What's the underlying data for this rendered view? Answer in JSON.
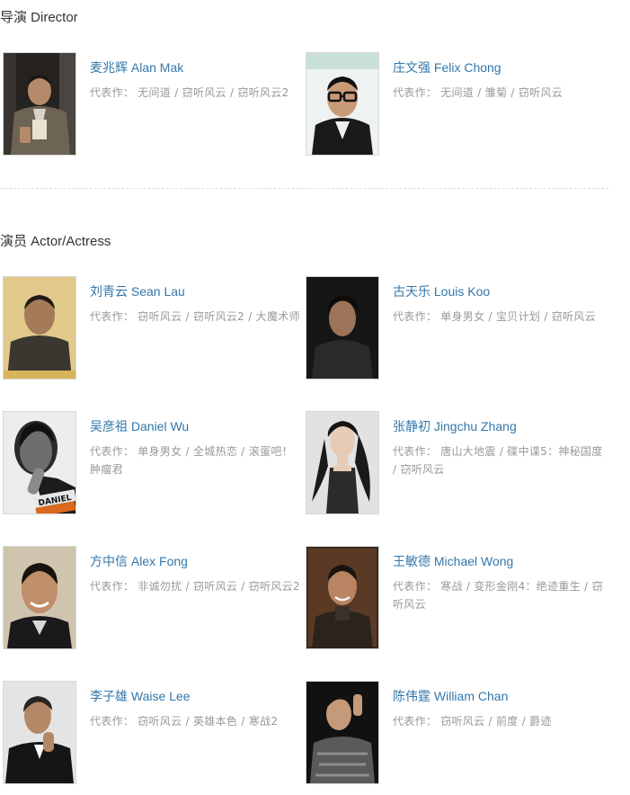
{
  "sections": {
    "director": {
      "title": "导演 Director",
      "people": [
        {
          "name": "麦兆辉 Alan Mak",
          "works_label": "代表作：",
          "works": "无间道 / 窃听风云 / 窃听风云2"
        },
        {
          "name": "庄文强 Felix Chong",
          "works_label": "代表作：",
          "works": "无间道 / 雏菊 / 窃听风云"
        }
      ]
    },
    "actor": {
      "title": "演员 Actor/Actress",
      "people": [
        {
          "name": "刘青云 Sean Lau",
          "works_label": "代表作：",
          "works": "窃听风云 / 窃听风云2 / 大魔术师"
        },
        {
          "name": "古天乐 Louis Koo",
          "works_label": "代表作：",
          "works": "单身男女 / 宝贝计划 / 窃听风云"
        },
        {
          "name": "吴彦祖 Daniel Wu",
          "works_label": "代表作：",
          "works": "单身男女 / 全城热恋 / 滚蛋吧！肿瘤君"
        },
        {
          "name": "张静初 Jingchu Zhang",
          "works_label": "代表作：",
          "works": "唐山大地震 / 碟中谍5：神秘国度 / 窃听风云"
        },
        {
          "name": "方中信 Alex Fong",
          "works_label": "代表作：",
          "works": "非诚勿扰 / 窃听风云 / 窃听风云2"
        },
        {
          "name": "王敏德 Michael Wong",
          "works_label": "代表作：",
          "works": "寒战 / 变形金刚4：绝迹重生 / 窃听风云"
        },
        {
          "name": "李子雄 Waise Lee",
          "works_label": "代表作：",
          "works": "窃听风云 / 英雄本色 / 寒战2"
        },
        {
          "name": "陈伟霆 William Chan",
          "works_label": "代表作：",
          "works": "窃听风云 / 前度 / 爵迹"
        }
      ]
    }
  },
  "photo_text": {
    "daniel_shirt": "DANIEL"
  },
  "colors": {
    "name_link": "#3377aa",
    "secondary_text": "#999999",
    "title_text": "#333333",
    "divider": "#dddddd"
  }
}
